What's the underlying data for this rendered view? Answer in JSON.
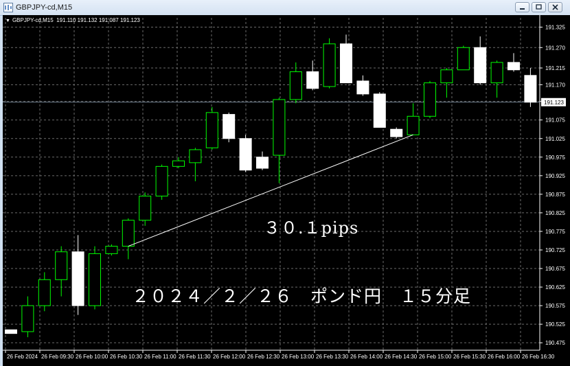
{
  "window": {
    "title": "GBPJPY-cd,M15"
  },
  "chart_header": {
    "symbol": "GBPJPY-cd,M15",
    "values": "191.110 191.132 191.087 191.123"
  },
  "annotations": {
    "pips": "３０.１pips",
    "caption": "２０２４／２／２６　ポンド円　１５分足"
  },
  "colors": {
    "background": "#000000",
    "grid": "#6c6c6c",
    "bull_body": "#000000",
    "bull_border": "#00ff00",
    "bear_body": "#ffffff",
    "bear_border": "#ffffff",
    "bid_line": "#6f7f8f",
    "text": "#ffffff"
  },
  "chart_data": {
    "type": "candlestick",
    "title": "GBPJPY-cd,M15",
    "ylim": [
      190.455,
      191.35
    ],
    "y_ticks": [
      "191.325",
      "191.270",
      "191.215",
      "191.170",
      "191.125",
      "191.075",
      "191.025",
      "190.975",
      "190.925",
      "190.875",
      "190.825",
      "190.775",
      "190.725",
      "190.675",
      "190.625",
      "190.575",
      "190.525",
      "190.475"
    ],
    "x_ticks": [
      "26 Feb 2024",
      "26 Feb 09:30",
      "26 Feb 10:00",
      "26 Feb 10:30",
      "26 Feb 11:00",
      "26 Feb 11:30",
      "26 Feb 12:00",
      "26 Feb 12:30",
      "26 Feb 13:00",
      "26 Feb 13:30",
      "26 Feb 14:00",
      "26 Feb 14:30",
      "26 Feb 15:00",
      "26 Feb 15:30",
      "26 Feb 16:00",
      "26 Feb 16:30"
    ],
    "current_price": "191.123",
    "candles": [
      {
        "o": 190.51,
        "h": 190.51,
        "l": 190.5,
        "c": 190.5
      },
      {
        "o": 190.505,
        "h": 190.6,
        "l": 190.49,
        "c": 190.575
      },
      {
        "o": 190.575,
        "h": 190.665,
        "l": 190.56,
        "c": 190.645
      },
      {
        "o": 190.645,
        "h": 190.735,
        "l": 190.6,
        "c": 190.72
      },
      {
        "o": 190.72,
        "h": 190.765,
        "l": 190.55,
        "c": 190.575
      },
      {
        "o": 190.575,
        "h": 190.735,
        "l": 190.565,
        "c": 190.715
      },
      {
        "o": 190.715,
        "h": 190.74,
        "l": 190.71,
        "c": 190.735
      },
      {
        "o": 190.735,
        "h": 190.81,
        "l": 190.7,
        "c": 190.805
      },
      {
        "o": 190.805,
        "h": 190.88,
        "l": 190.79,
        "c": 190.87
      },
      {
        "o": 190.87,
        "h": 190.955,
        "l": 190.86,
        "c": 190.95
      },
      {
        "o": 190.95,
        "h": 190.975,
        "l": 190.945,
        "c": 190.965
      },
      {
        "o": 190.96,
        "h": 191.0,
        "l": 190.91,
        "c": 190.995
      },
      {
        "o": 191.0,
        "h": 191.11,
        "l": 190.995,
        "c": 191.095
      },
      {
        "o": 191.09,
        "h": 191.095,
        "l": 191.015,
        "c": 191.025
      },
      {
        "o": 191.025,
        "h": 191.035,
        "l": 190.935,
        "c": 190.94
      },
      {
        "o": 190.975,
        "h": 190.99,
        "l": 190.94,
        "c": 190.945
      },
      {
        "o": 190.98,
        "h": 191.135,
        "l": 190.905,
        "c": 191.13
      },
      {
        "o": 191.13,
        "h": 191.23,
        "l": 191.12,
        "c": 191.205
      },
      {
        "o": 191.205,
        "h": 191.235,
        "l": 191.155,
        "c": 191.16
      },
      {
        "o": 191.165,
        "h": 191.295,
        "l": 191.16,
        "c": 191.28
      },
      {
        "o": 191.28,
        "h": 191.305,
        "l": 191.18,
        "c": 191.175
      },
      {
        "o": 191.18,
        "h": 191.195,
        "l": 191.14,
        "c": 191.145
      },
      {
        "o": 191.145,
        "h": 191.15,
        "l": 191.055,
        "c": 191.055
      },
      {
        "o": 191.05,
        "h": 191.055,
        "l": 191.025,
        "c": 191.03
      },
      {
        "o": 191.035,
        "h": 191.12,
        "l": 191.035,
        "c": 191.085
      },
      {
        "o": 191.085,
        "h": 191.18,
        "l": 191.08,
        "c": 191.175
      },
      {
        "o": 191.175,
        "h": 191.215,
        "l": 191.135,
        "c": 191.21
      },
      {
        "o": 191.21,
        "h": 191.275,
        "l": 191.21,
        "c": 191.27
      },
      {
        "o": 191.27,
        "h": 191.3,
        "l": 191.17,
        "c": 191.175
      },
      {
        "o": 191.175,
        "h": 191.235,
        "l": 191.135,
        "c": 191.23
      },
      {
        "o": 191.23,
        "h": 191.255,
        "l": 191.205,
        "c": 191.21
      },
      {
        "o": 191.195,
        "h": 191.215,
        "l": 191.11,
        "c": 191.123
      }
    ],
    "trendline": {
      "from_index": 7,
      "from_price": 190.735,
      "to_index": 24,
      "to_price": 191.035
    }
  }
}
